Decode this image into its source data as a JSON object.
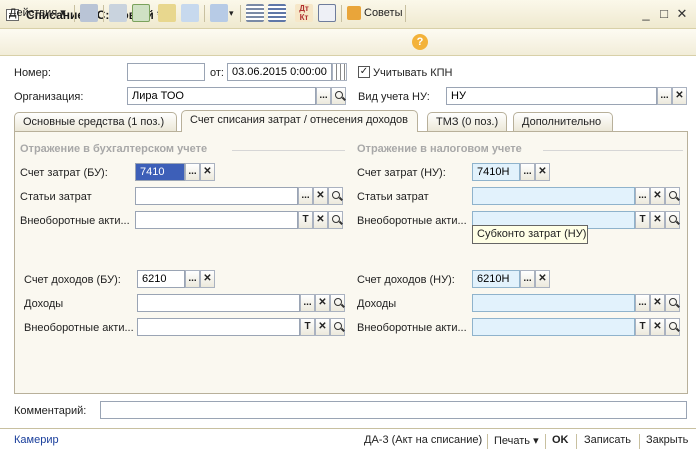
{
  "window": {
    "title": "Списание ОС: Новый *",
    "minimize": "_",
    "maximize": "□",
    "close": "✕"
  },
  "toolbar": {
    "actions_label": "Действия",
    "advice_label": "Советы",
    "help_glyph": "?",
    "icons": [
      "post-document-icon",
      "copy-icon",
      "add-icon",
      "reports-icon",
      "goto-icon",
      "structure-icon",
      "list-icon",
      "dt-kt-icon",
      "journal-icon",
      "advice-icon",
      "help-icon"
    ]
  },
  "header": {
    "number_label": "Номер:",
    "number_value": "",
    "date_label": "от:",
    "date_value": "03.06.2015  0:00:00",
    "kpn_label": "Учитывать КПН",
    "kpn_checked": true,
    "org_label": "Организация:",
    "org_value": "Лира ТОО",
    "nu_label": "Вид учета НУ:",
    "nu_value": "НУ"
  },
  "tabs": [
    {
      "label": "Основные средства (1 поз.)",
      "active": false
    },
    {
      "label": "Счет списания затрат / отнесения доходов",
      "active": true
    },
    {
      "label": "ТМЗ (0 поз.)",
      "active": false
    },
    {
      "label": "Дополнительно",
      "active": false
    }
  ],
  "bu": {
    "section_title": "Отражение в бухгалтерском учете",
    "expense_account_label": "Счет затрат (БУ):",
    "expense_account_value": "7410",
    "expense_items_label": "Статьи затрат",
    "expense_items_value": "",
    "fixed_assets_label": "Внеоборотные акти...",
    "fixed_assets_value": "",
    "income_account_label": "Счет доходов (БУ):",
    "income_account_value": "6210",
    "income_label": "Доходы",
    "income_value": "",
    "fixed_assets2_label": "Внеоборотные акти...",
    "fixed_assets2_value": ""
  },
  "nu": {
    "section_title": "Отражение в налоговом учете",
    "expense_account_label": "Счет затрат (НУ):",
    "expense_account_value": "7410Н",
    "expense_items_label": "Статьи затрат",
    "expense_items_value": "",
    "fixed_assets_label": "Внеоборотные акти...",
    "fixed_assets_value": "",
    "income_account_label": "Счет доходов (НУ):",
    "income_account_value": "6210Н",
    "income_label": "Доходы",
    "income_value": "",
    "fixed_assets2_label": "Внеоборотные акти...",
    "fixed_assets2_value": ""
  },
  "tooltip": "Субконто затрат (НУ)",
  "comment": {
    "label": "Комментарий:",
    "value": ""
  },
  "footer": {
    "user_link": "Камерир",
    "print_form": "ДА-3 (Акт на списание)",
    "print_label": "Печать",
    "ok_label": "OK",
    "save_label": "Записать",
    "close_label": "Закрыть"
  },
  "buttons": {
    "select": "...",
    "clear": "✕",
    "type": "T",
    "dropdown": "▾"
  },
  "colors": {
    "accent_field": "#e2f2fc",
    "selected": "#3d5fb8",
    "section_text": "#a8a8a8",
    "link": "#1a3f9c"
  }
}
